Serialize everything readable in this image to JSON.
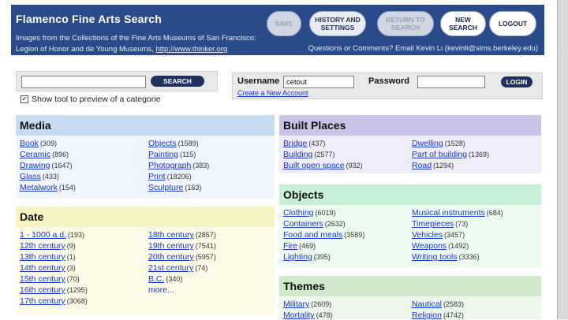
{
  "header": {
    "title": "Flamenco Fine Arts Search",
    "info_line1": "Images from the Collections of the Fine Arts Museums of San Francisco:",
    "info_line2_prefix": "Legion of Honor and de Young Museums, ",
    "info_link": "http://www.thinker.org",
    "contact": "Questions or Comments? Email Kevin Li (kevinli@sims.berkeley.edu)",
    "buttons": {
      "save": "SAVE",
      "history_1": "HISTORY AND",
      "history_2": "SETTINGS",
      "return_1": "RETURN TO",
      "return_2": "SEARCH",
      "new_1": "NEW",
      "new_2": "SEARCH",
      "logout": "LOGOUT"
    }
  },
  "search": {
    "value": "",
    "placeholder": "",
    "button": "SEARCH",
    "preview_checked": true,
    "preview_label": "Show tool to preview of a categorie"
  },
  "login": {
    "username_label": "Username",
    "username_value": "cetout",
    "password_label": "Password",
    "password_value": "",
    "button": "LOGIN",
    "create_link": "Create a New Account"
  },
  "panels": {
    "media": {
      "title": "Media",
      "color": "#c6dcf3",
      "body_color": "#f0f6fd",
      "items": [
        {
          "label": "Book",
          "count": "(309)"
        },
        {
          "label": "Ceramic",
          "count": "(896)"
        },
        {
          "label": "Drawing",
          "count": "(1647)"
        },
        {
          "label": "Glass",
          "count": "(433)"
        },
        {
          "label": "Metalwork",
          "count": "(154)"
        },
        {
          "label": "Objects",
          "count": "(1589)"
        },
        {
          "label": "Painting",
          "count": "(115)"
        },
        {
          "label": "Photograph",
          "count": "(383)"
        },
        {
          "label": "Print",
          "count": "(18206)"
        },
        {
          "label": "Sculpture",
          "count": "(163)"
        }
      ]
    },
    "date": {
      "title": "Date",
      "color": "#f5f3c2",
      "body_color": "#fcfbe8",
      "items": [
        {
          "label": "1 - 1000 a.d.",
          "count": "(193)"
        },
        {
          "label": "12th century",
          "count": "(9)"
        },
        {
          "label": "13th century",
          "count": "(1)"
        },
        {
          "label": "14th century",
          "count": "(3)"
        },
        {
          "label": "15th century",
          "count": "(70)"
        },
        {
          "label": "16th century",
          "count": "(1295)"
        },
        {
          "label": "17th century",
          "count": "(3068)"
        },
        {
          "label": "18th century",
          "count": "(2857)"
        },
        {
          "label": "19th century",
          "count": "(7541)"
        },
        {
          "label": "20th century",
          "count": "(5957)"
        },
        {
          "label": "21st century",
          "count": "(74)"
        },
        {
          "label": "B.C.",
          "count": "(340)"
        },
        {
          "label": "more...",
          "count": ""
        }
      ]
    },
    "built": {
      "title": "Built Places",
      "color": "#c9c3e7",
      "body_color": "#efedf9",
      "items": [
        {
          "label": "Bridge",
          "count": "(437)"
        },
        {
          "label": "Building",
          "count": "(2577)"
        },
        {
          "label": "Built open space",
          "count": "(932)"
        },
        {
          "label": "Dwelling",
          "count": "(1528)"
        },
        {
          "label": "Part of building",
          "count": "(1369)"
        },
        {
          "label": "Road",
          "count": "(1294)"
        }
      ]
    },
    "objects": {
      "title": "Objects",
      "color": "#c6f0d8",
      "body_color": "#eefbf3",
      "items": [
        {
          "label": "Clothing",
          "count": "(6019)"
        },
        {
          "label": "Containers",
          "count": "(2632)"
        },
        {
          "label": "Food and meals",
          "count": "(3589)"
        },
        {
          "label": "Fire",
          "count": "(469)"
        },
        {
          "label": "Lighting",
          "count": "(395)"
        },
        {
          "label": "Musical instruments",
          "count": "(684)"
        },
        {
          "label": "Timepieces",
          "count": "(73)"
        },
        {
          "label": "Vehicles",
          "count": "(3457)"
        },
        {
          "label": "Weapons",
          "count": "(1492)"
        },
        {
          "label": "Writing tools",
          "count": "(3336)"
        }
      ]
    },
    "themes": {
      "title": "Themes",
      "color": "#cfe8c9",
      "body_color": "#eef7ec",
      "items": [
        {
          "label": "Military",
          "count": "(2609)"
        },
        {
          "label": "Mortality",
          "count": "(478)"
        },
        {
          "label": "Nautical",
          "count": "(2583)"
        },
        {
          "label": "Religion",
          "count": "(4742)"
        }
      ]
    }
  }
}
